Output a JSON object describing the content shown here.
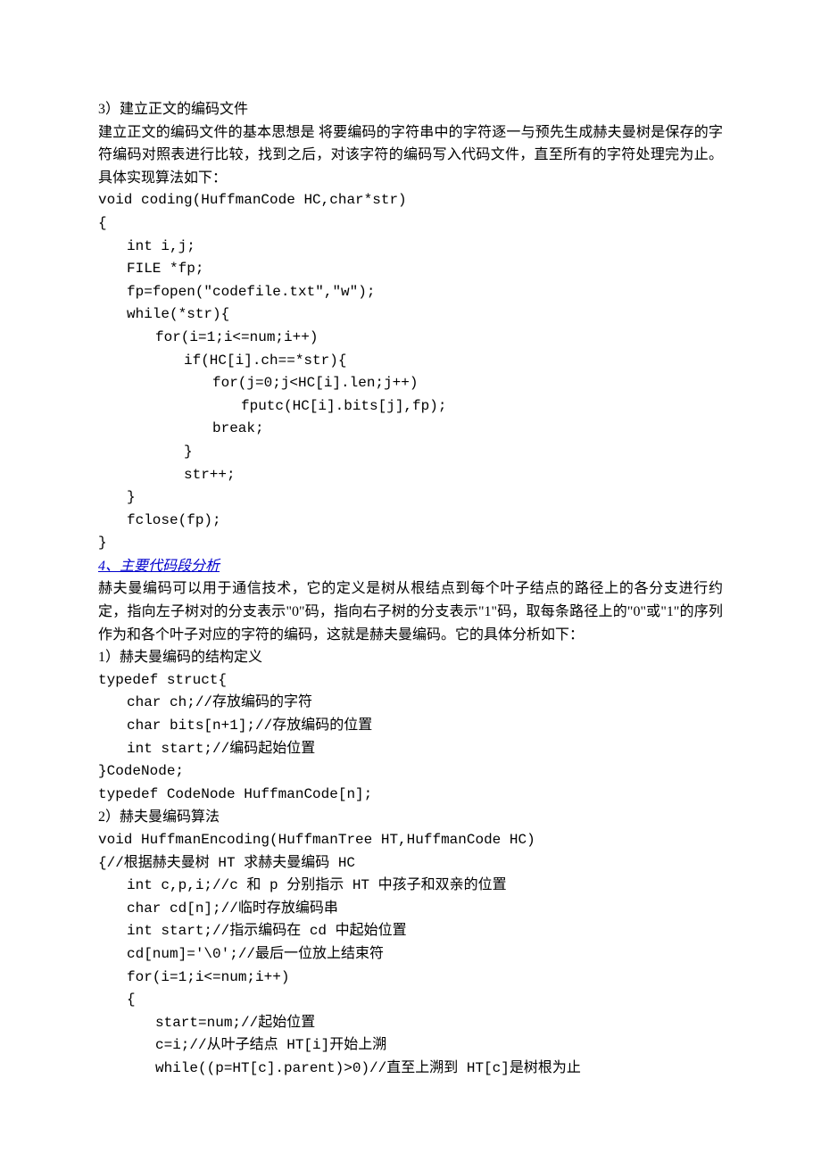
{
  "s3": {
    "title": "3）建立正文的编码文件",
    "p1": "建立正文的编码文件的基本思想是 将要编码的字符串中的字符逐一与预先生成赫夫曼树是保存的字符编码对照表进行比较，找到之后，对该字符的编码写入代码文件，直至所有的字符处理完为止。具体实现算法如下：",
    "c": [
      "void coding(HuffmanCode HC,char*str)",
      "{",
      "int i,j;",
      "FILE *fp;",
      "fp=fopen(\"codefile.txt\",\"w\");",
      "while(*str){",
      "for(i=1;i<=num;i++)",
      "if(HC[i].ch==*str){",
      "for(j=0;j<HC[i].len;j++)",
      "fputc(HC[i].bits[j],fp);",
      "break;",
      "}",
      "str++;",
      "}",
      "fclose(fp);",
      "}"
    ]
  },
  "s4": {
    "title": "4、主要代码段分析",
    "p1": "赫夫曼编码可以用于通信技术，它的定义是树从根结点到每个叶子结点的路径上的各分支进行约定，指向左子树对的分支表示\"0\"码，指向右子树的分支表示\"1\"码，取每条路径上的\"0\"或\"1\"的序列作为和各个叶子对应的字符的编码，这就是赫夫曼编码。它的具体分析如下：",
    "h1": "1）赫夫曼编码的结构定义",
    "c1": [
      "typedef struct{",
      "char ch;//存放编码的字符",
      "char bits[n+1];//存放编码的位置",
      "int start;//编码起始位置",
      "}CodeNode;",
      "typedef CodeNode HuffmanCode[n];"
    ],
    "h2": "2）赫夫曼编码算法",
    "c2": [
      "void HuffmanEncoding(HuffmanTree HT,HuffmanCode HC)",
      "{//根据赫夫曼树 HT 求赫夫曼编码 HC",
      "int c,p,i;//c 和 p 分别指示 HT 中孩子和双亲的位置",
      "char cd[n];//临时存放编码串",
      "int start;//指示编码在 cd 中起始位置",
      "cd[num]='\\0';//最后一位放上结束符",
      "for(i=1;i<=num;i++)",
      "{",
      "start=num;//起始位置",
      "c=i;//从叶子结点 HT[i]开始上溯",
      "while((p=HT[c].parent)>0)//直至上溯到 HT[c]是树根为止"
    ]
  }
}
